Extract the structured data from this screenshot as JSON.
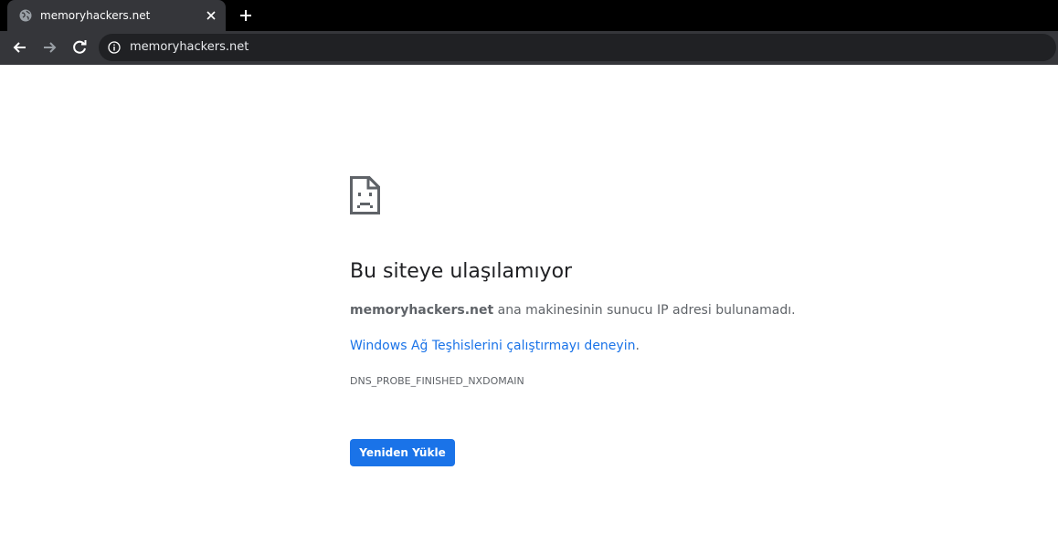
{
  "tab": {
    "title": "memoryhackers.net",
    "favicon": "globe-icon",
    "close": "close-icon"
  },
  "toolbar": {
    "back": "back-arrow-icon",
    "forward": "forward-arrow-icon",
    "reload": "reload-icon",
    "new_tab": "plus-icon"
  },
  "omnibox": {
    "icon": "info-icon",
    "url": "memoryhackers.net"
  },
  "error": {
    "icon": "sad-document-icon",
    "heading": "Bu siteye ulaşılamıyor",
    "host": "memoryhackers.net",
    "description_rest": " ana makinesinin sunucu IP adresi bulunamadı.",
    "diagnostics_link": "Windows Ağ Teşhislerini çalıştırmayı deneyin",
    "diagnostics_suffix": ".",
    "code": "DNS_PROBE_FINISHED_NXDOMAIN",
    "reload_button": "Yeniden Yükle"
  },
  "colors": {
    "tabstrip_bg": "#000000",
    "tab_bg": "#35363a",
    "omnibox_bg": "#202124",
    "link": "#1a73e8",
    "button": "#1a73e8",
    "text": "#5f6368",
    "heading": "#202124"
  }
}
